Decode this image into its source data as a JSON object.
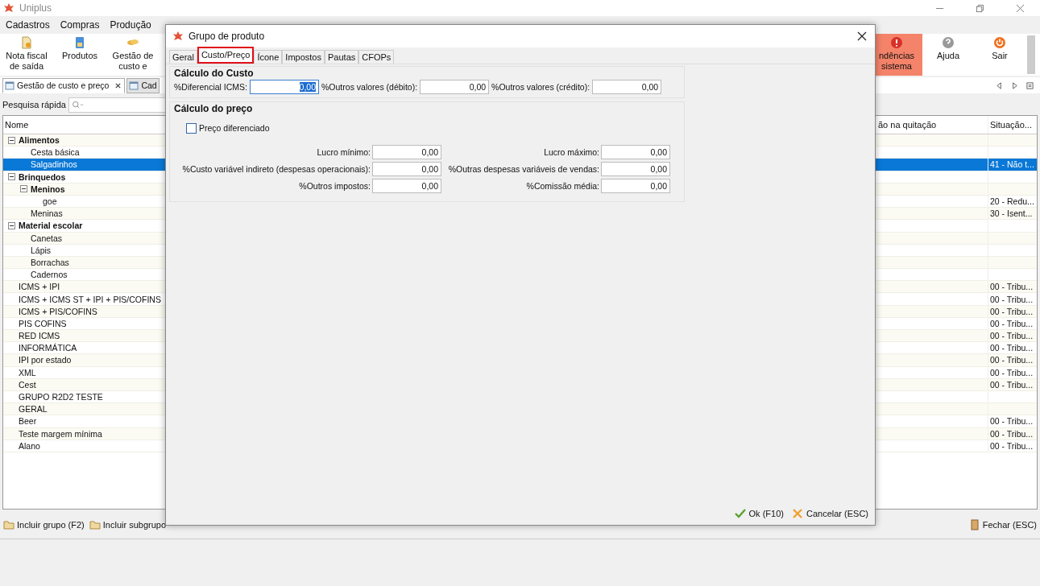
{
  "app": {
    "title": "Uniplus",
    "menu": [
      "Cadastros",
      "Compras",
      "Produção"
    ],
    "toolbar": [
      {
        "lines": [
          "Nota fiscal",
          "de saída"
        ]
      },
      {
        "lines": [
          "Produtos"
        ]
      },
      {
        "lines": [
          "Gestão de",
          "custo e"
        ]
      }
    ],
    "toolbar_right": [
      {
        "lines": [
          "ndências",
          "sistema"
        ],
        "highlighted": true
      },
      {
        "lines": [
          "Ajuda"
        ],
        "highlighted": false
      },
      {
        "lines": [
          "Sair"
        ],
        "highlighted": false
      }
    ],
    "tabs": [
      {
        "label": "Gestão de custo e preço",
        "closable": true,
        "selected": true
      },
      {
        "label": "Cad",
        "closable": false,
        "selected": false
      }
    ],
    "search": {
      "label": "Pesquisa rápida"
    },
    "table": {
      "columns": [
        "Nome",
        "ão na quitação",
        "Situação..."
      ],
      "rows": [
        {
          "name": "Alimentos",
          "expanded": true,
          "selected": false,
          "children": [
            {
              "name": "Cesta básica",
              "selected": false
            },
            {
              "name": "Salgadinhos",
              "situacao": "41 - Não t...",
              "selected": true
            }
          ]
        },
        {
          "name": "Brinquedos",
          "expanded": true,
          "selected": false,
          "children": [
            {
              "name": "Meninos",
              "expanded": true,
              "selected": false,
              "children": [
                {
                  "name": "goe",
                  "situacao": "20 - Redu...",
                  "selected": false
                }
              ]
            },
            {
              "name": "Meninas",
              "situacao": "30 - Isent...",
              "selected": false
            }
          ]
        },
        {
          "name": "Material escolar",
          "expanded": true,
          "selected": false,
          "children": [
            {
              "name": "Canetas",
              "selected": false
            },
            {
              "name": "Lápis",
              "selected": false
            },
            {
              "name": "Borrachas",
              "selected": false
            },
            {
              "name": "Cadernos",
              "selected": false
            }
          ]
        },
        {
          "name": "ICMS + IPI",
          "situacao": "00 - Tribu...",
          "selected": false
        },
        {
          "name": "ICMS +  ICMS ST + IPI + PIS/COFINS",
          "situacao": "00 - Tribu...",
          "selected": false
        },
        {
          "name": "ICMS  + PIS/COFINS",
          "situacao": "00 - Tribu...",
          "selected": false
        },
        {
          "name": "PIS COFINS",
          "situacao": "00 - Tribu...",
          "selected": false
        },
        {
          "name": "RED ICMS",
          "situacao": "00 - Tribu...",
          "selected": false
        },
        {
          "name": "INFORMÁTICA",
          "situacao": "00 - Tribu...",
          "selected": false
        },
        {
          "name": "IPI por estado",
          "situacao": "00 - Tribu...",
          "selected": false
        },
        {
          "name": "XML",
          "situacao": "00 - Tribu...",
          "selected": false
        },
        {
          "name": "Cest",
          "situacao": "00 - Tribu...",
          "selected": false
        },
        {
          "name": "GRUPO R2D2 TESTE",
          "selected": false
        },
        {
          "name": "GERAL",
          "selected": false
        },
        {
          "name": "Beer",
          "situacao": "00 - Tribu...",
          "selected": false
        },
        {
          "name": "Teste margem mínima",
          "situacao": "00 - Tribu...",
          "selected": false
        },
        {
          "name": "Alano",
          "situacao": "00 - Tribu...",
          "selected": false
        }
      ]
    },
    "actions": [
      "Incluir grupo (F2)",
      "Incluir subgrupo"
    ],
    "close_button": "Fechar (ESC)"
  },
  "dialog": {
    "title": "Grupo de produto",
    "tabs": [
      {
        "label": "Geral",
        "selected": false
      },
      {
        "label": "Custo/Preço",
        "selected": true
      },
      {
        "label": "Ícone",
        "selected": false
      },
      {
        "label": "Impostos",
        "selected": false
      },
      {
        "label": "Pautas",
        "selected": false
      },
      {
        "label": "CFOPs",
        "selected": false
      }
    ],
    "cost_section": {
      "title": "Cálculo do Custo",
      "fields": [
        {
          "label": "%Diferencial ICMS:",
          "value": "0,00",
          "focused": true
        },
        {
          "label": "%Outros valores (débito):",
          "value": "0,00",
          "focused": false
        },
        {
          "label": "%Outros valores (crédito):",
          "value": "0,00",
          "focused": false
        }
      ]
    },
    "price_section": {
      "title": "Cálculo do preço",
      "checkbox": {
        "label": "Preço diferenciado",
        "checked": false
      },
      "fields": [
        {
          "label": "Lucro mínimo:",
          "value": "0,00"
        },
        {
          "label": "Lucro máximo:",
          "value": "0,00"
        },
        {
          "label": "%Custo variável indireto (despesas operacionais):",
          "value": "0,00"
        },
        {
          "label": "%Outras despesas variáveis de vendas:",
          "value": "0,00"
        },
        {
          "label": "%Outros impostos:",
          "value": "0,00"
        },
        {
          "label": "%Comissão média:",
          "value": "0,00"
        }
      ]
    },
    "buttons": [
      "Ok (F10)",
      "Cancelar (ESC)"
    ]
  }
}
